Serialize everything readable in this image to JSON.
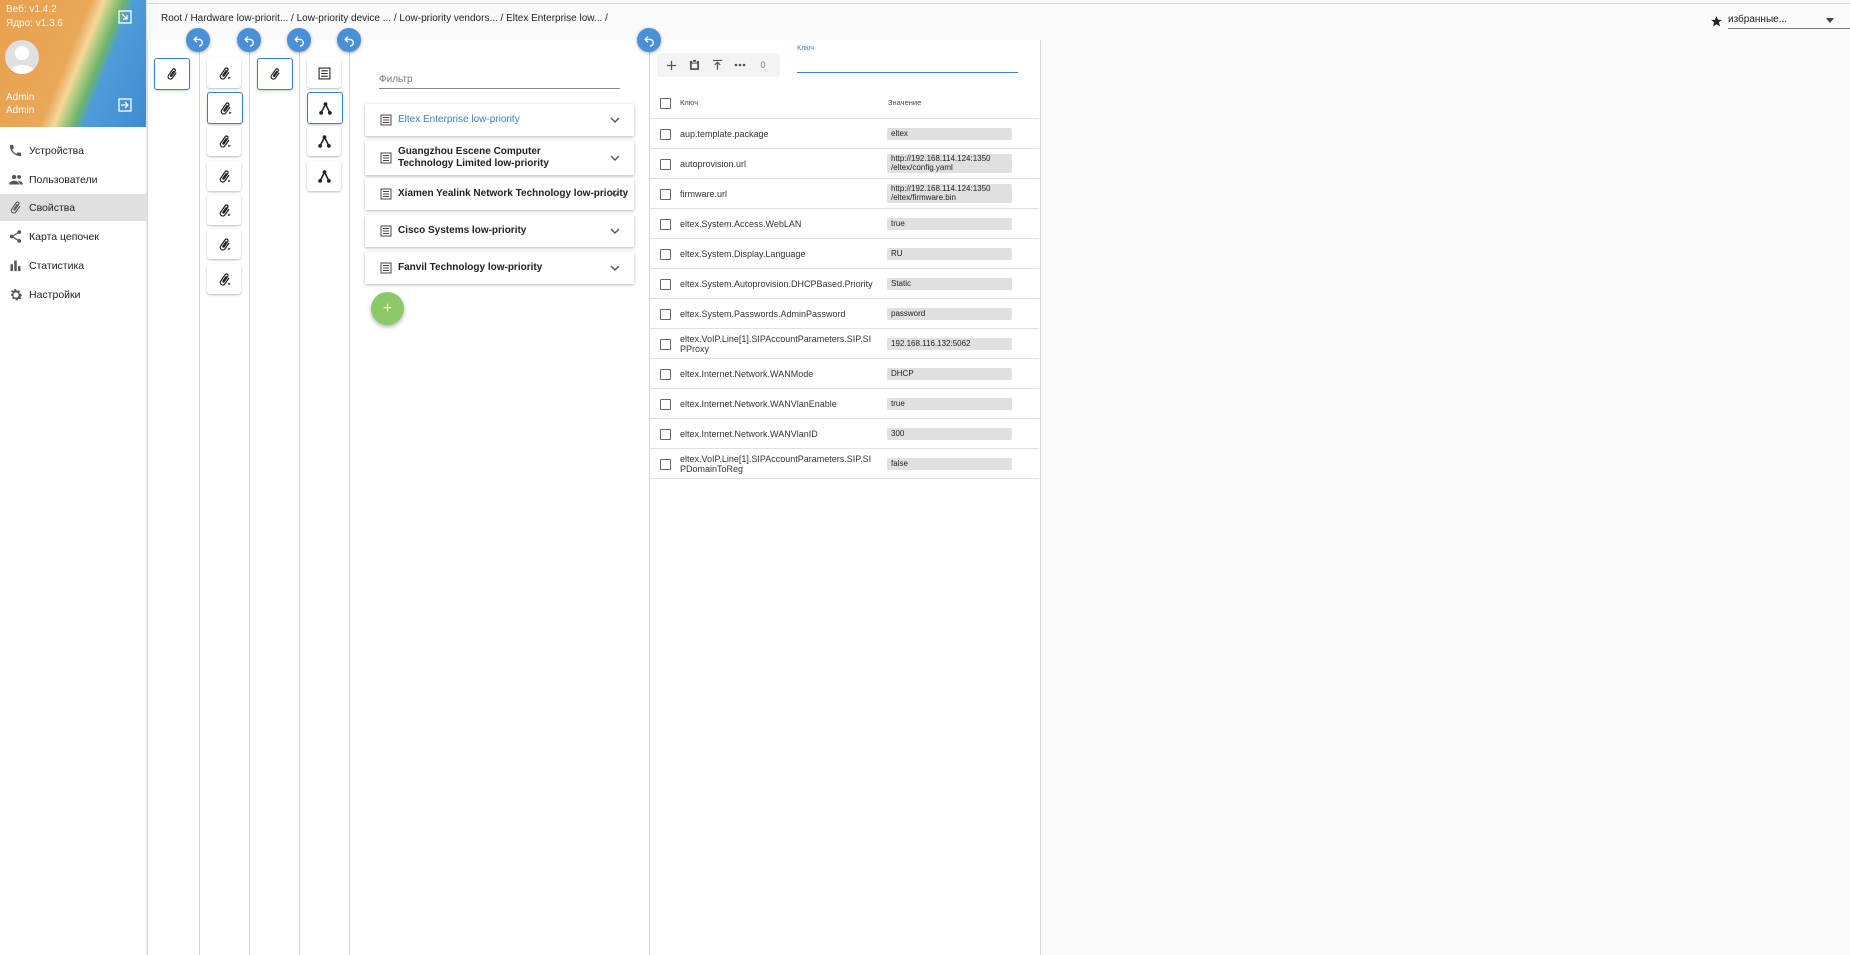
{
  "sidebar": {
    "version_web": "Веб: v1.4.2",
    "version_core": "Ядро: v1.3.6",
    "user_name": "Admin",
    "user_role": "Admin",
    "items": [
      {
        "label": "Устройства",
        "icon": "phone-icon"
      },
      {
        "label": "Пользователи",
        "icon": "users-icon"
      },
      {
        "label": "Свойства",
        "icon": "paperclip-icon",
        "active": true
      },
      {
        "label": "Карта цепочек",
        "icon": "share-icon"
      },
      {
        "label": "Статистика",
        "icon": "bar-chart-icon"
      },
      {
        "label": "Настройки",
        "icon": "gear-icon"
      }
    ]
  },
  "breadcrumb": "Root / Hardware low-priorit... / Low-priority device ... / Low-priority vendors... / Eltex Enterprise low... /",
  "favorites": {
    "placeholder": "избранные..."
  },
  "vendors": {
    "filter_placeholder": "Фильтр",
    "items": [
      {
        "name": "Eltex Enterprise low-priority",
        "active": true
      },
      {
        "name": "Guangzhou Escene Computer Technology Limited low-priority"
      },
      {
        "name": "Xiamen Yealink Network Technology low-priority"
      },
      {
        "name": "Cisco Systems low-priority"
      },
      {
        "name": "Fanvil Technology low-priority"
      }
    ],
    "add_label": "+"
  },
  "properties": {
    "selected_count": "0",
    "key_label": "Ключ",
    "col_key": "Ключ",
    "col_value": "Значение",
    "accent": "#3a7fc4",
    "rows": [
      {
        "key": "aup.template.package",
        "value": "eltex"
      },
      {
        "key": "autoprovision.url",
        "value": "http://192.168.114.124:1350\n/eltex/config.yaml"
      },
      {
        "key": "firmware.url",
        "value": "http://192.168.114.124:1350\n/eltex/firmware.bin"
      },
      {
        "key": "eltex.System.Access.WebLAN",
        "value": "true"
      },
      {
        "key": "eltex.System.Display.Language",
        "value": "RU"
      },
      {
        "key": "eltex.System.Autoprovision.DHCPBased.Priority",
        "value": "Static"
      },
      {
        "key": "eltex.System.Passwords.AdminPassword",
        "value": "password"
      },
      {
        "key": "eltex.VoIP.Line[1].SIPAccountParameters.SIP.SIPProxy",
        "value": "192.168.116.132:5062"
      },
      {
        "key": "eltex.Internet.Network.WANMode",
        "value": "DHCP"
      },
      {
        "key": "eltex.Internet.Network.WANVlanEnable",
        "value": "true"
      },
      {
        "key": "eltex.Internet.Network.WANVlanID",
        "value": "300"
      },
      {
        "key": "eltex.VoIP.Line[1].SIPAccountParameters.SIP.SIPDomainToReg",
        "value": "false"
      }
    ]
  }
}
